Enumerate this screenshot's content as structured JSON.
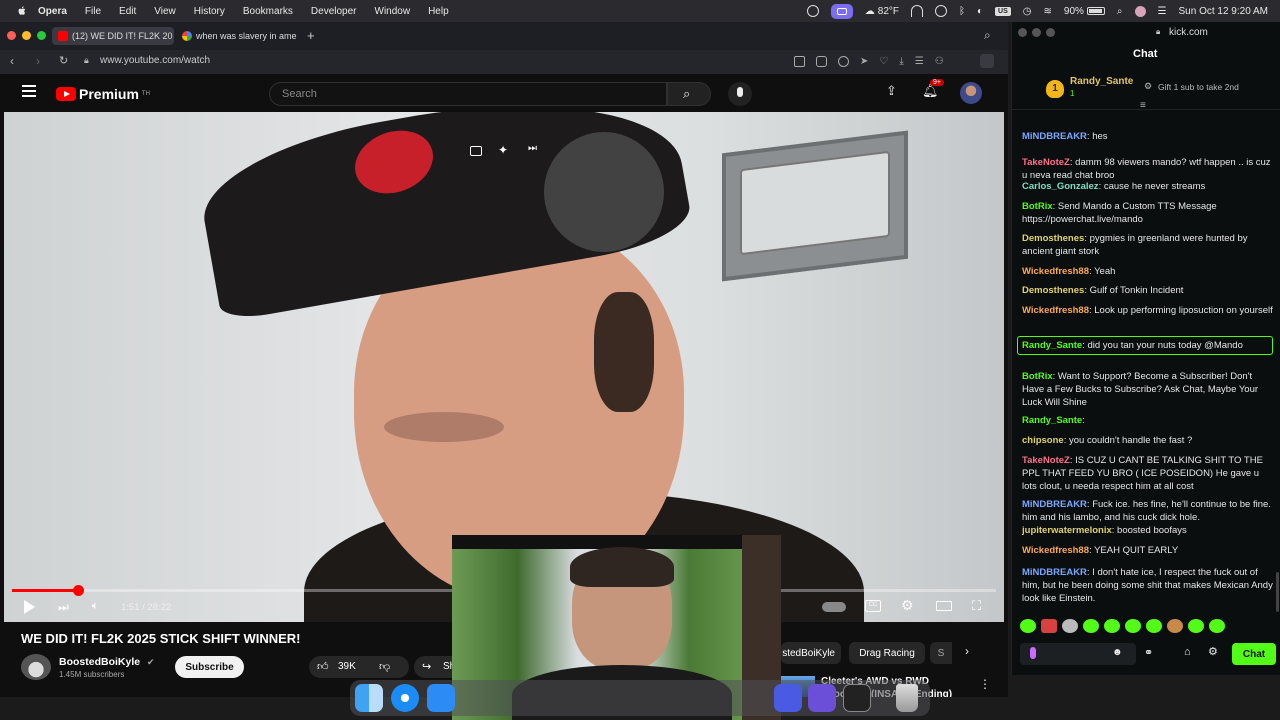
{
  "menubar": {
    "app": "Opera",
    "items": [
      "File",
      "Edit",
      "View",
      "History",
      "Bookmarks",
      "Developer",
      "Window",
      "Help"
    ],
    "weather": "82°F",
    "battery": "90%",
    "datetime": "Sun Oct 12  9:20 AM"
  },
  "browser": {
    "tabs": [
      {
        "label": "(12) WE DID IT! FL2K 20",
        "active": true
      },
      {
        "label": "when was slavery in ame",
        "active": false
      }
    ],
    "url": "www.youtube.com/watch"
  },
  "youtube": {
    "logo_text": "Premium",
    "logo_sup": "TH",
    "search_placeholder": "Search",
    "notif_count": "9+",
    "time_display": "1:51 / 28:22",
    "progress_fraction": 0.067,
    "video_title": "WE DID IT! FL2K 2025 STICK SHIFT WINNER!",
    "channel_name": "BoostedBoiKyle",
    "subscribers": "1.45M subscribers",
    "subscribe_label": "Subscribe",
    "likes": "39K",
    "share_label": "Sh",
    "chips": [
      "stedBoiKyle",
      "Drag Racing",
      "S"
    ],
    "rec_title_1": "Cleeter's AWD vs RWD",
    "rec_title_2": "Shootout! (INSANE Ending)"
  },
  "kick": {
    "site": "kick.com",
    "title": "Chat",
    "pinned_user": "Randy_Sante",
    "pinned_rank": "1",
    "pinned_count": "1",
    "gift_text": "Gift 1 sub to take 2nd",
    "chat_button": "Chat",
    "messages": [
      {
        "user": "MiNDBREAKR",
        "color": "#7aa7ff",
        "text": "hes"
      },
      {
        "user": "TakeNoteZ",
        "color": "#ff6f8a",
        "text": "damm 98 viewers mando? wtf happen .. is cuz u neva read chat broo"
      },
      {
        "user": "Carlos_Gonzalez",
        "color": "#7ce0c3",
        "text": "cause he never streams"
      },
      {
        "user": "BotRix",
        "color": "#53fc18",
        "text": "Send Mando a Custom TTS Message https://powerchat.live/mando"
      },
      {
        "user": "Demosthenes",
        "color": "#e0d36b",
        "text": "pygmies in greenland were hunted by ancient giant stork"
      },
      {
        "user": "Wickedfresh88",
        "color": "#ffa94d",
        "text": "Yeah"
      },
      {
        "user": "Demosthenes",
        "color": "#e0d36b",
        "text": "Gulf of Tonkin Incident"
      },
      {
        "user": "Wickedfresh88",
        "color": "#ffa94d",
        "text": "Look up performing liposuction on yourself"
      },
      {
        "user": "Randy_Sante",
        "color": "#53fc18",
        "text": "did you tan your nuts today @Mando"
      },
      {
        "user": "BotRix",
        "color": "#53fc18",
        "text": "Want to Support? Become a Subscriber! Don't Have a Few Bucks to Subscribe? Ask Chat, Maybe Your Luck Will Shine"
      },
      {
        "user": "Randy_Sante",
        "color": "#53fc18",
        "text": ""
      },
      {
        "user": "chipsone",
        "color": "#e0d36b",
        "text": "you couldn't handle the fast ?"
      },
      {
        "user": "TakeNoteZ",
        "color": "#ff6f8a",
        "text": "IS CUZ U CANT BE TALKING SHIT TO THE PPL THAT FEED YU BRO ( ICE POSEIDON) He gave u lots clout, u needa respect him at all cost"
      },
      {
        "user": "MiNDBREAKR",
        "color": "#7aa7ff",
        "text": "Fuck ice. hes fine, he'll continue to be fine. him and his lambo, and his cuck dick hole."
      },
      {
        "user": "jupiterwatermelonix",
        "color": "#e0d36b",
        "text": "boosted boofays"
      },
      {
        "user": "Wickedfresh88",
        "color": "#ffa94d",
        "text": "YEAH QUIT EARLY"
      },
      {
        "user": "MiNDBREAKR",
        "color": "#7aa7ff",
        "text": "I don't hate ice, I respect the fuck out of him, but he been doing some shit that makes Mexican Andy look like Einstein."
      }
    ]
  }
}
